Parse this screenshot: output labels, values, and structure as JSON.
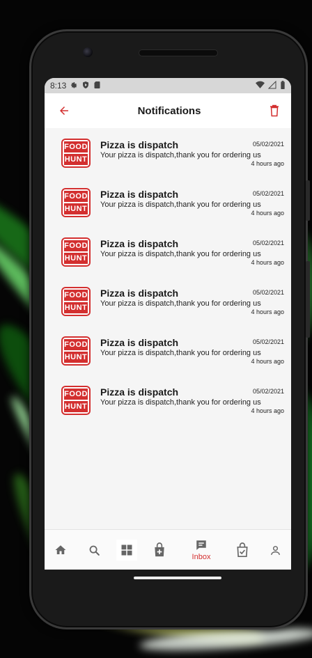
{
  "status_bar": {
    "time": "8:13"
  },
  "header": {
    "title": "Notifications"
  },
  "notifications": [
    {
      "brand_top": "FOOD",
      "brand_bottom": "HUNT",
      "title": "Pizza is dispatch",
      "date": "05/02/2021",
      "body": "Your pizza is dispatch,thank you for ordering us",
      "ago": "4 hours ago"
    },
    {
      "brand_top": "FOOD",
      "brand_bottom": "HUNT",
      "title": "Pizza is dispatch",
      "date": "05/02/2021",
      "body": "Your pizza is dispatch,thank you for ordering us",
      "ago": "4 hours ago"
    },
    {
      "brand_top": "FOOD",
      "brand_bottom": "HUNT",
      "title": "Pizza is dispatch",
      "date": "05/02/2021",
      "body": "Your pizza is dispatch,thank you for ordering us",
      "ago": "4 hours ago"
    },
    {
      "brand_top": "FOOD",
      "brand_bottom": "HUNT",
      "title": "Pizza is dispatch",
      "date": "05/02/2021",
      "body": "Your pizza is dispatch,thank you for ordering us",
      "ago": "4 hours ago"
    },
    {
      "brand_top": "FOOD",
      "brand_bottom": "HUNT",
      "title": "Pizza is dispatch",
      "date": "05/02/2021",
      "body": "Your pizza is dispatch,thank you for ordering us",
      "ago": "4 hours ago"
    },
    {
      "brand_top": "FOOD",
      "brand_bottom": "HUNT",
      "title": "Pizza is dispatch",
      "date": "05/02/2021",
      "body": "Your pizza is dispatch,thank you for ordering us",
      "ago": "4 hours ago"
    }
  ],
  "bottom_nav": {
    "items": [
      {
        "icon": "home-icon"
      },
      {
        "icon": "search-icon"
      },
      {
        "icon": "grid-icon"
      },
      {
        "icon": "bag-plus-icon"
      },
      {
        "icon": "inbox-icon",
        "label": "Inbox",
        "active": true
      },
      {
        "icon": "bag-check-icon"
      },
      {
        "icon": "profile-icon"
      }
    ]
  },
  "colors": {
    "accent": "#d32f2f",
    "icon": "#666666"
  }
}
